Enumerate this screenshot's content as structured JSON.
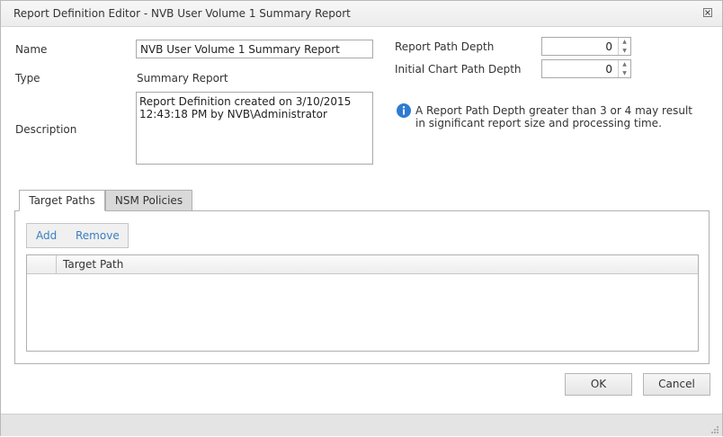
{
  "window": {
    "title": "Report Definition Editor - NVB User Volume 1 Summary Report"
  },
  "form": {
    "name_label": "Name",
    "name_value": "NVB User Volume 1 Summary Report",
    "type_label": "Type",
    "type_value": "Summary Report",
    "description_label": "Description",
    "description_value": "Report Definition created on 3/10/2015 12:43:18 PM by NVB\\Administrator",
    "report_path_depth_label": "Report Path Depth",
    "report_path_depth_value": "0",
    "initial_chart_path_depth_label": "Initial Chart Path Depth",
    "initial_chart_path_depth_value": "0",
    "info_message": "A Report Path Depth greater than 3 or 4 may result in significant report size and processing time."
  },
  "tabs": [
    {
      "label": "Target Paths",
      "active": true
    },
    {
      "label": "NSM Policies",
      "active": false
    }
  ],
  "toolbar": {
    "add_label": "Add",
    "remove_label": "Remove"
  },
  "grid": {
    "columns": [
      "Target Path"
    ],
    "rows": []
  },
  "buttons": {
    "ok_label": "OK",
    "cancel_label": "Cancel"
  },
  "colors": {
    "link": "#3a7fc0",
    "info_icon": "#2f7bd1"
  }
}
